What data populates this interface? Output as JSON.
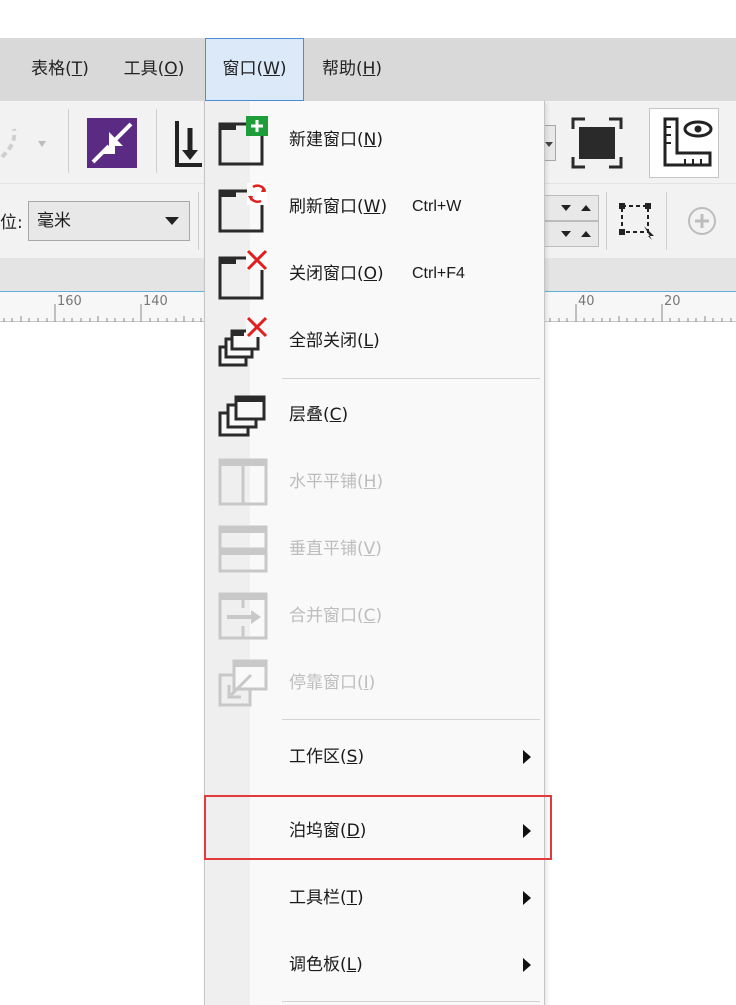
{
  "menubar": {
    "items": [
      {
        "label": "表格(",
        "acc": "T",
        "tail": ")"
      },
      {
        "label": "工具(",
        "acc": "O",
        "tail": ")"
      },
      {
        "label": "窗口(",
        "acc": "W",
        "tail": ")"
      },
      {
        "label": "帮助(",
        "acc": "H",
        "tail": ")"
      }
    ]
  },
  "propbar": {
    "unit_label": "位:",
    "unit_value": "毫米"
  },
  "ruler": {
    "labels": [
      "160",
      "140",
      "40",
      "20"
    ]
  },
  "window_menu": {
    "items": [
      {
        "label": "新建窗口(",
        "acc": "N",
        "tail": ")",
        "shortcut": "",
        "enabled": true,
        "icon": "new-window-icon"
      },
      {
        "label": "刷新窗口(",
        "acc": "W",
        "tail": ")",
        "shortcut": "Ctrl+W",
        "enabled": true,
        "icon": "refresh-window-icon"
      },
      {
        "label": "关闭窗口(",
        "acc": "O",
        "tail": ")",
        "shortcut": "Ctrl+F4",
        "enabled": true,
        "icon": "close-window-icon"
      },
      {
        "label": "全部关闭(",
        "acc": "L",
        "tail": ")",
        "shortcut": "",
        "enabled": true,
        "icon": "close-all-icon"
      },
      {
        "label": "层叠(",
        "acc": "C",
        "tail": ")",
        "shortcut": "",
        "enabled": true,
        "icon": "cascade-icon"
      },
      {
        "label": "水平平铺(",
        "acc": "H",
        "tail": ")",
        "shortcut": "",
        "enabled": false,
        "icon": "tile-horizontal-icon"
      },
      {
        "label": "垂直平铺(",
        "acc": "V",
        "tail": ")",
        "shortcut": "",
        "enabled": false,
        "icon": "tile-vertical-icon"
      },
      {
        "label": "合并窗口(",
        "acc": "C",
        "tail": ")",
        "shortcut": "",
        "enabled": false,
        "icon": "merge-windows-icon"
      },
      {
        "label": "停靠窗口(",
        "acc": "I",
        "tail": ")",
        "shortcut": "",
        "enabled": false,
        "icon": "dock-window-icon"
      }
    ],
    "submenus": [
      {
        "label": "工作区(",
        "acc": "S",
        "tail": ")"
      },
      {
        "label": "泊坞窗(",
        "acc": "D",
        "tail": ")"
      },
      {
        "label": "工具栏(",
        "acc": "T",
        "tail": ")"
      },
      {
        "label": "调色板(",
        "acc": "L",
        "tail": ")"
      }
    ]
  },
  "colors": {
    "highlight": "#e03a3a",
    "add_green": "#1e9e3a",
    "close_red": "#e02020",
    "active_menu_bg": "#dbe9f9",
    "purple_tool": "#5b2a82"
  }
}
